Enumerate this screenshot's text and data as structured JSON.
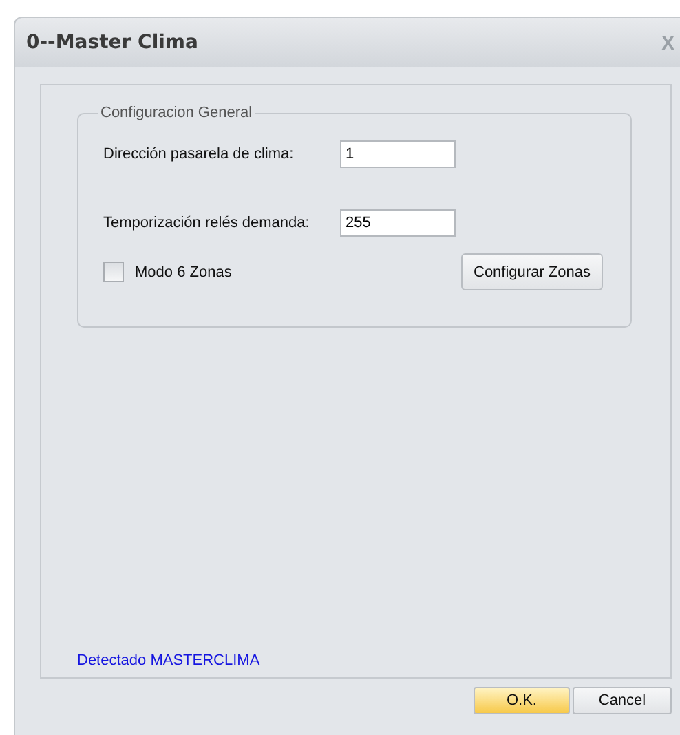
{
  "window": {
    "title": "0--Master Clima",
    "close": "X"
  },
  "group": {
    "title": "Configuracion General",
    "fields": [
      {
        "label": "Dirección pasarela de clima:",
        "value": "1"
      },
      {
        "label": "Temporización relés demanda:",
        "value": "255"
      }
    ],
    "checkbox": {
      "label": "Modo 6 Zonas",
      "checked": false
    },
    "button": "Configurar Zonas"
  },
  "status": "Detectado MASTERCLIMA",
  "buttons": [
    {
      "label": "O.K.",
      "default": true
    },
    {
      "label": "Cancel",
      "default": false
    }
  ]
}
